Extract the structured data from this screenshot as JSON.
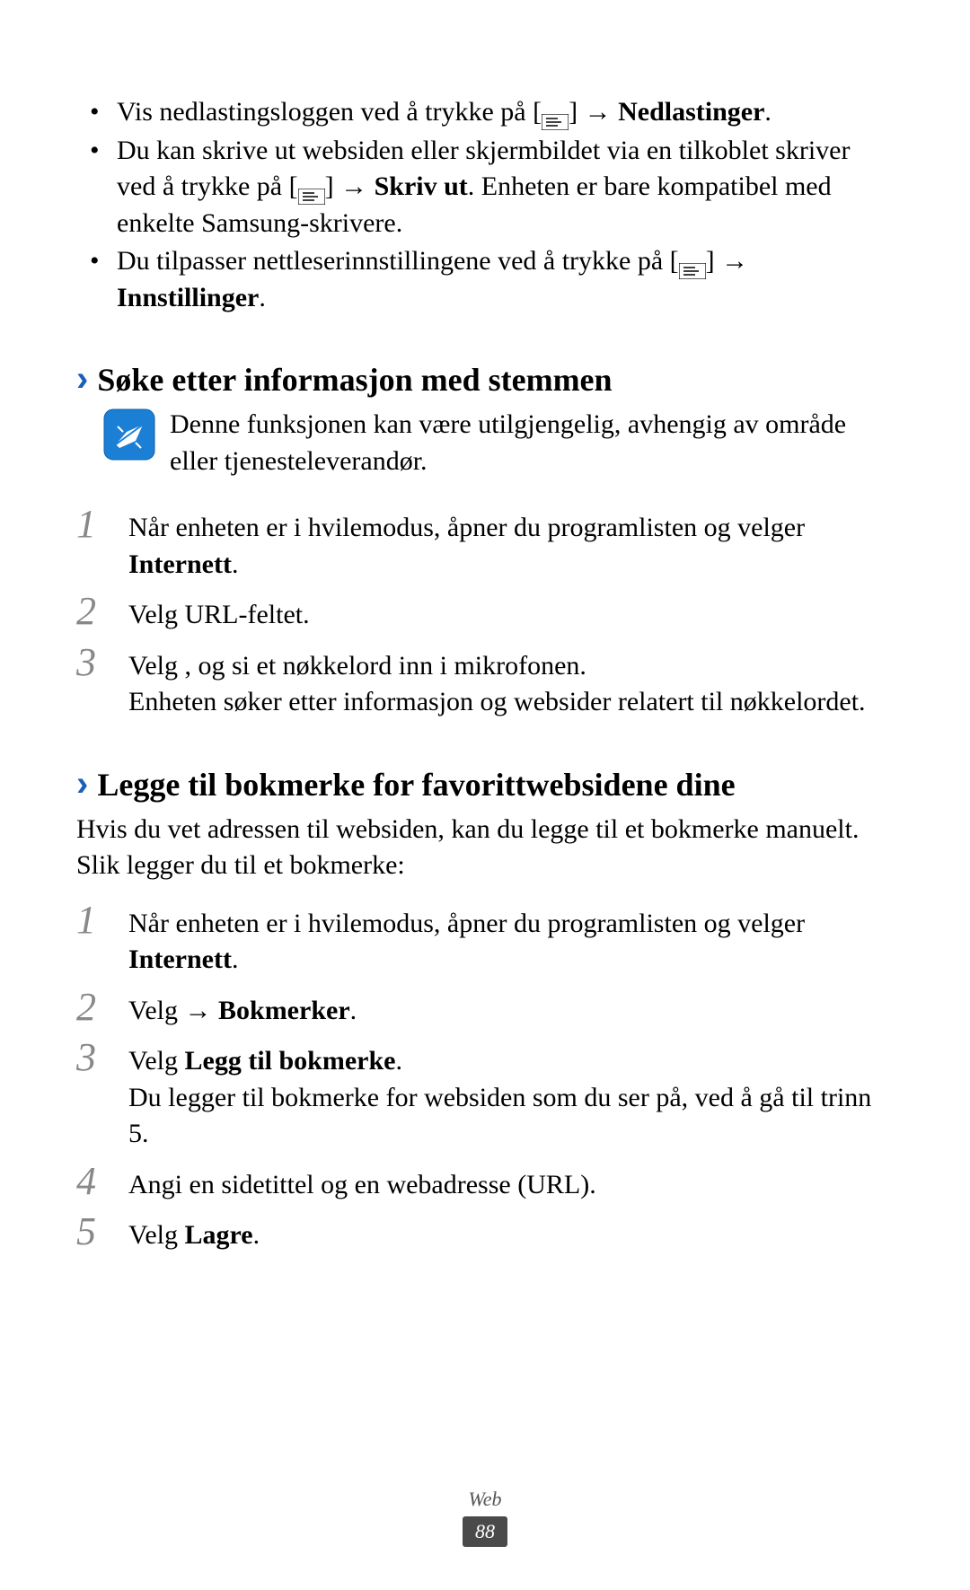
{
  "bullets": [
    {
      "pre": "Vis nedlastingsloggen ved å trykke på [",
      "post_icon": "] → ",
      "bold1": "Nedlastinger",
      "tail": "."
    },
    {
      "pre": "Du kan skrive ut websiden eller skjermbildet via en tilkoblet skriver ved å trykke på [",
      "post_icon": "] → ",
      "bold1": "Skriv ut",
      "tail": ". Enheten er bare kompatibel med enkelte Samsung-skrivere."
    },
    {
      "pre": "Du tilpasser nettleserinnstillingene ved å trykke på [",
      "post_icon": "] → ",
      "bold1": "Innstillinger",
      "tail": "."
    }
  ],
  "section1": {
    "heading": "Søke etter informasjon med stemmen",
    "note": "Denne funksjonen kan være utilgjengelig, avhengig av område eller tjenesteleverandør.",
    "steps": [
      {
        "num": "1",
        "pre": "Når enheten er i hvilemodus, åpner du programlisten og velger ",
        "bold": "Internett",
        "tail": "."
      },
      {
        "num": "2",
        "pre": "Velg URL-feltet.",
        "bold": "",
        "tail": ""
      },
      {
        "num": "3",
        "pre": "Velg   , og si et nøkkelord inn i mikrofonen.",
        "bold": "",
        "tail": "",
        "extra": "Enheten søker etter informasjon og websider relatert til nøkkelordet."
      }
    ]
  },
  "section2": {
    "heading": "Legge til bokmerke for favorittwebsidene dine",
    "intro": "Hvis du vet adressen til websiden, kan du legge til et bokmerke manuelt. Slik legger du til et bokmerke:",
    "steps": [
      {
        "num": "1",
        "pre": "Når enheten er i hvilemodus, åpner du programlisten og velger ",
        "bold": "Internett",
        "tail": "."
      },
      {
        "num": "2",
        "pre": "Velg    → ",
        "bold": "Bokmerker",
        "tail": "."
      },
      {
        "num": "3",
        "pre": "Velg ",
        "bold": "Legg til bokmerke",
        "tail": ".",
        "extra": "Du legger til bokmerke for websiden som du ser på, ved å gå til trinn 5."
      },
      {
        "num": "4",
        "pre": "Angi en sidetittel og en webadresse (URL).",
        "bold": "",
        "tail": ""
      },
      {
        "num": "5",
        "pre": "Velg ",
        "bold": "Lagre",
        "tail": "."
      }
    ]
  },
  "footer": {
    "section": "Web",
    "page": "88"
  }
}
